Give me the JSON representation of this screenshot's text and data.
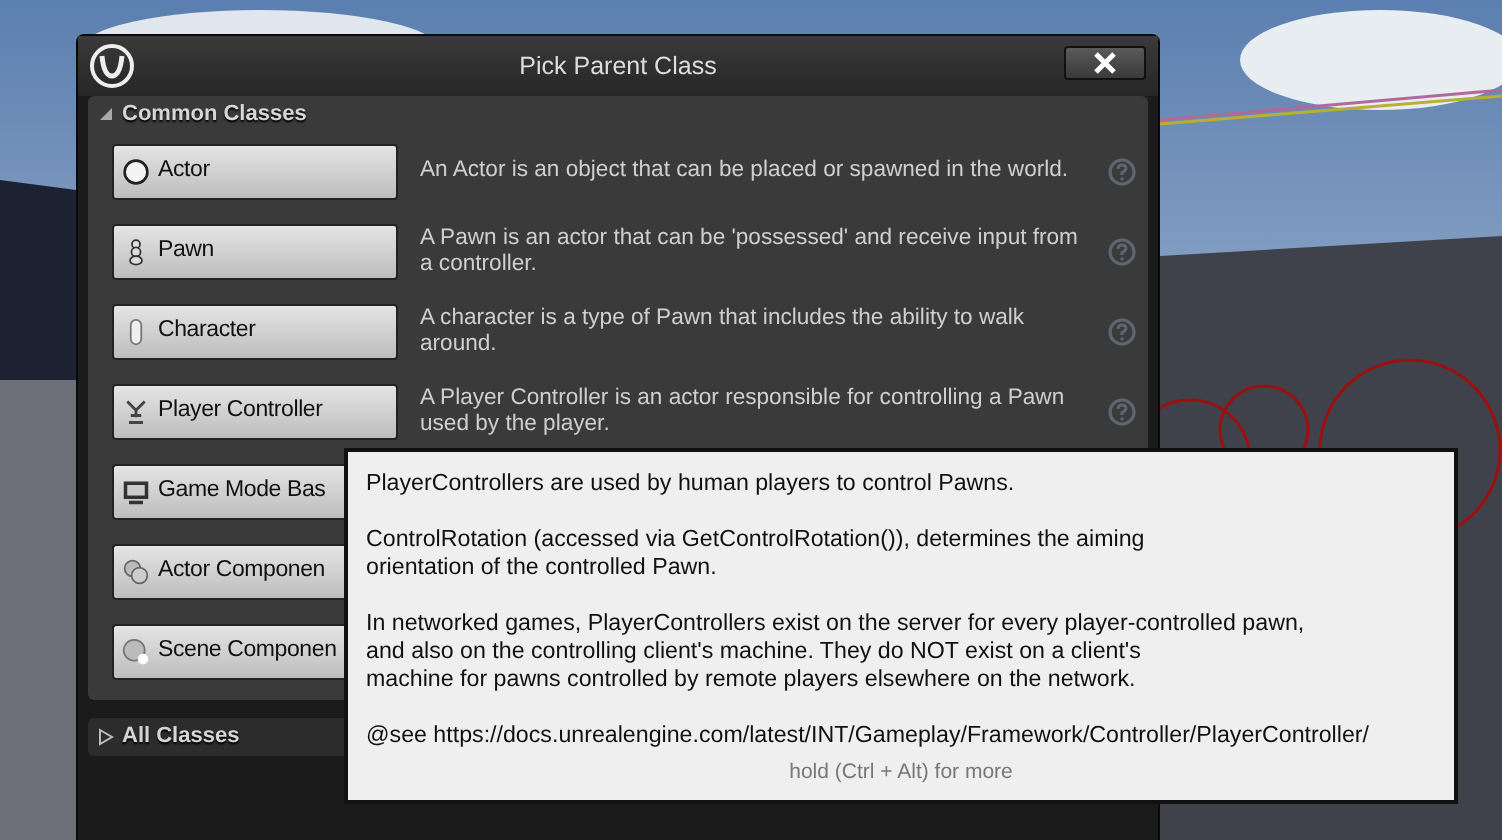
{
  "window": {
    "title": "Pick Parent Class"
  },
  "sections": [
    {
      "label": "Common Classes",
      "expanded": true,
      "classes": [
        {
          "label": "Actor",
          "kind": "sphere",
          "description": "An Actor is an object that can be placed or spawned in the world."
        },
        {
          "label": "Pawn",
          "kind": "pawn",
          "description": "A Pawn is an actor that can be 'possessed' and receive input from a controller."
        },
        {
          "label": "Character",
          "kind": "capsule",
          "description": "A character is a type of Pawn that includes the ability to walk around."
        },
        {
          "label": "Player Controller",
          "kind": "controller",
          "description": "A Player Controller is an actor responsible for controlling a Pawn used by the player."
        },
        {
          "label": "Game Mode Bas",
          "kind": "monitor"
        },
        {
          "label": "Actor Componen",
          "kind": "gears"
        },
        {
          "label": "Scene Componen",
          "kind": "scene"
        }
      ]
    },
    {
      "label": "All Classes",
      "expanded": false
    }
  ],
  "tooltip": {
    "paragraphs": [
      "PlayerControllers are used by human players to control Pawns.",
      "ControlRotation (accessed via GetControlRotation()), determines the aiming\norientation of the controlled Pawn.",
      "In networked games, PlayerControllers exist on the server for every player-controlled pawn,\nand also on the controlling client's machine. They do NOT exist on a client's\nmachine for pawns controlled by remote players elsewhere on the network.",
      "@see https://docs.unrealengine.com/latest/INT/Gameplay/Framework/Controller/PlayerController/"
    ],
    "hint": "hold (Ctrl + Alt) for more"
  }
}
